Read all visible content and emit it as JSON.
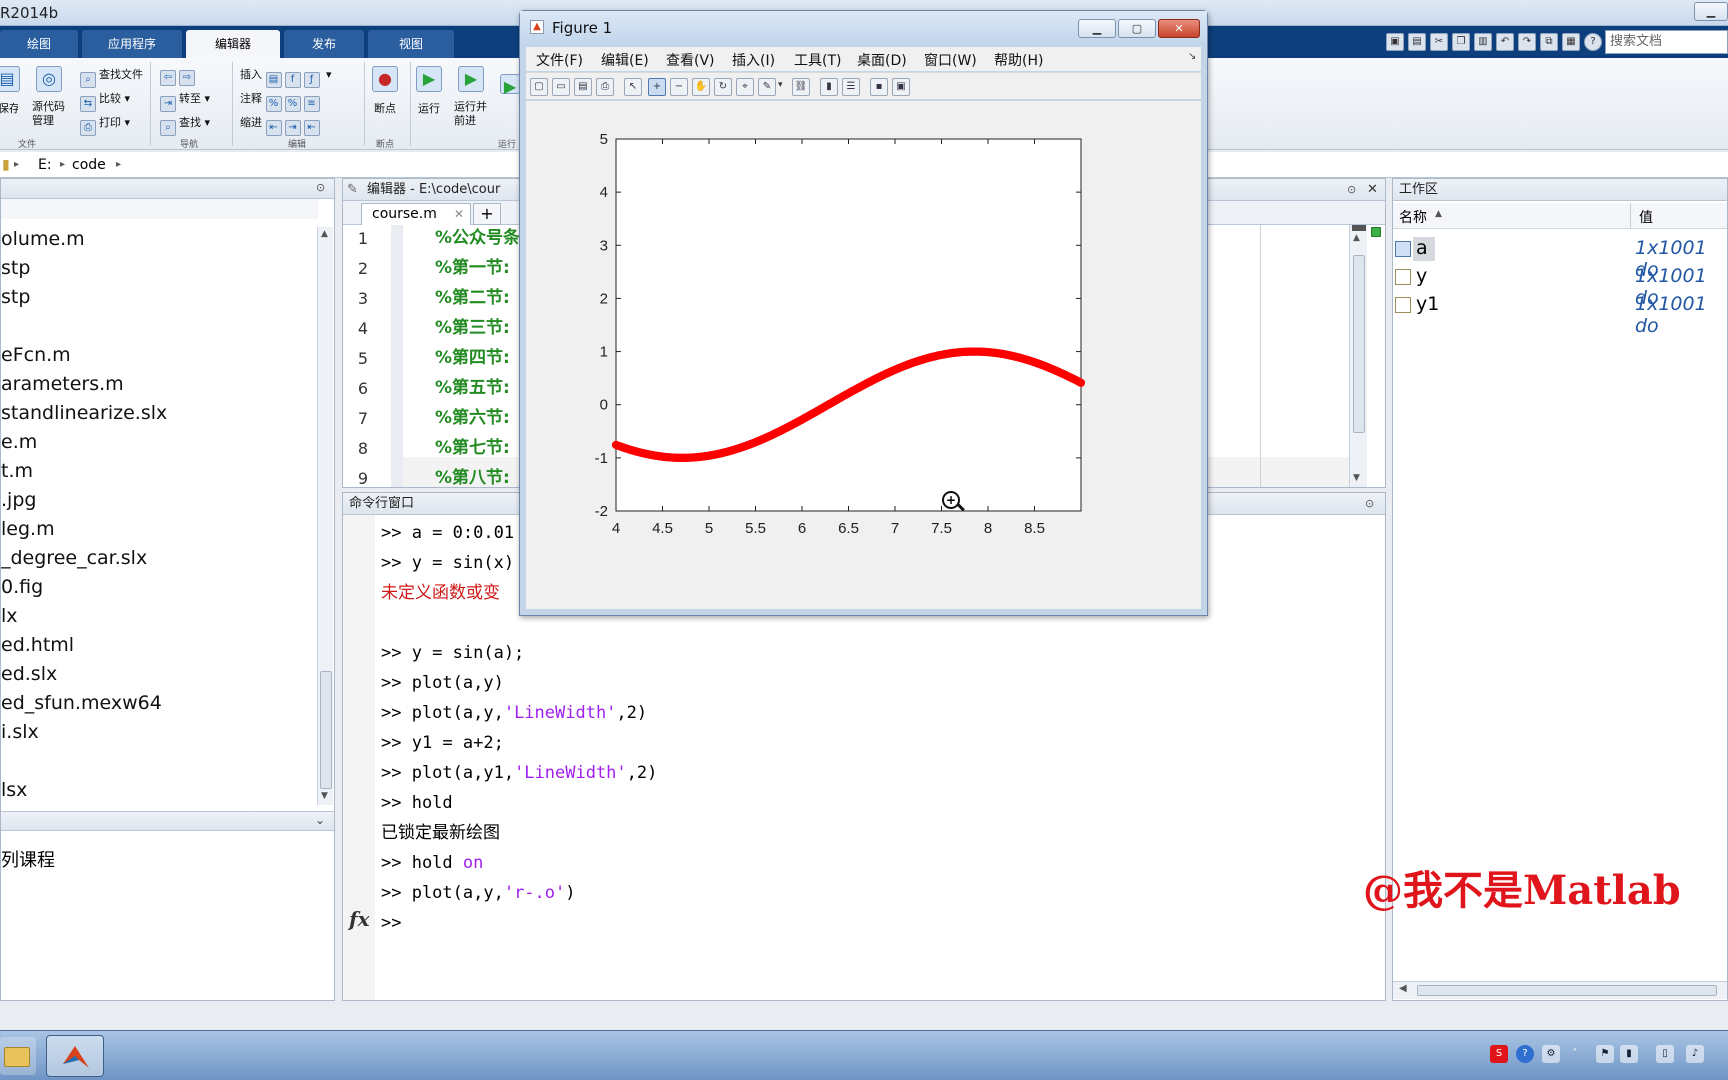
{
  "app": {
    "title_fragment": "R2014b"
  },
  "ribbon": {
    "tabs": [
      "绘图",
      "应用程序",
      "编辑器",
      "发布",
      "视图"
    ],
    "active_tab": 2,
    "items": {
      "save": "保存",
      "compare_to_source": "源代码\n管理",
      "find_files": "查找文件",
      "compare": "比较",
      "print": "打印",
      "goto": "转至",
      "find": "查找",
      "insert": "插入",
      "comment": "注释",
      "indent": "缩进",
      "breakpoints": "断点",
      "run": "运行",
      "run_advance": "运行并\n前进"
    },
    "groups": {
      "file": "文件",
      "navigate": "导航",
      "edit": "编辑",
      "breakpoints": "断点",
      "run": "运行"
    },
    "search_placeholder": "搜索文档"
  },
  "path": {
    "drive": "E:",
    "folder": "code"
  },
  "file_list": [
    "olume.m",
    "stp",
    "stp",
    "",
    "eFcn.m",
    "arameters.m",
    "standlinearize.slx",
    "e.m",
    "t.m",
    ".jpg",
    "leg.m",
    "_degree_car.slx",
    "0.fig",
    "lx",
    "ed.html",
    "ed.slx",
    "ed_sfun.mexw64",
    "i.slx",
    "",
    "lsx"
  ],
  "details_label": "列课程",
  "editor": {
    "title": "编辑器 - E:\\code\\cour",
    "tab": "course.m",
    "add_tab": "+",
    "lines": [
      {
        "n": "1",
        "text": "%公众号条"
      },
      {
        "n": "2",
        "text": "%第一节:"
      },
      {
        "n": "3",
        "text": "%第二节:"
      },
      {
        "n": "4",
        "text": "%第三节:"
      },
      {
        "n": "5",
        "text": "%第四节:"
      },
      {
        "n": "6",
        "text": "%第五节:"
      },
      {
        "n": "7",
        "text": "%第六节:"
      },
      {
        "n": "8",
        "text": "%第七节:"
      },
      {
        "n": "9",
        "text": "%第八节:"
      }
    ]
  },
  "command_window": {
    "title": "命令行窗口",
    "lines": {
      "l1": ">> a = 0:0.01",
      "l2": ">> y = sin(x)",
      "l3": "未定义函数或变",
      "l4": ">> y = sin(a);",
      "l5": ">> plot(a,y)",
      "l6a": ">> plot(a,y,",
      "l6s": "'LineWidth'",
      "l6b": ",2)",
      "l7": ">> y1 = a+2;",
      "l8a": ">> plot(a,y1,",
      "l8s": "'LineWidth'",
      "l8b": ",2)",
      "l9": ">> hold",
      "l10": "已锁定最新绘图",
      "l11a": ">> hold ",
      "l11k": "on",
      "l12a": ">> plot(a,y,",
      "l12s": "'r-.o'",
      "l12b": ")",
      "l13": ">>"
    },
    "fx": "fx"
  },
  "workspace": {
    "title": "工作区",
    "col_name": "名称",
    "col_value": "值",
    "rows": [
      {
        "name": "a",
        "value": "1x1001 do"
      },
      {
        "name": "y",
        "value": "1x1001 do"
      },
      {
        "name": "y1",
        "value": "1x1001 do"
      }
    ]
  },
  "figure": {
    "title": "Figure 1",
    "menus": [
      "文件(F)",
      "编辑(E)",
      "查看(V)",
      "插入(I)",
      "工具(T)",
      "桌面(D)",
      "窗口(W)",
      "帮助(H)"
    ]
  },
  "chart_data": {
    "type": "line",
    "title": "",
    "xlabel": "",
    "ylabel": "",
    "xlim": [
      4,
      9
    ],
    "ylim": [
      -2,
      5
    ],
    "xticks": [
      4,
      4.5,
      5,
      5.5,
      6,
      6.5,
      7,
      7.5,
      8,
      8.5
    ],
    "yticks": [
      -2,
      -1,
      0,
      1,
      2,
      3,
      4,
      5
    ],
    "series": [
      {
        "function": "sin",
        "x_start": 4,
        "x_end": 9,
        "x_step": 0.01,
        "style": "r-.o",
        "color": "#ff0000"
      }
    ],
    "grid": false
  },
  "watermark": "@我不是Matlab"
}
